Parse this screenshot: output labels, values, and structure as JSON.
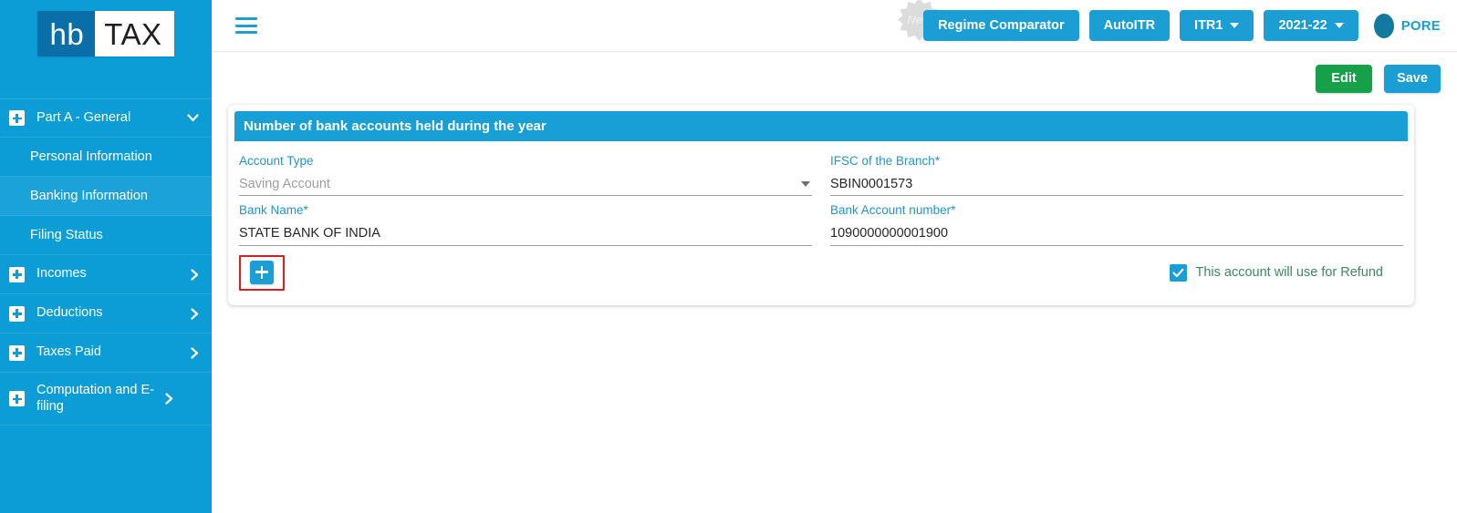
{
  "brand": {
    "logo_mark": "hb",
    "logo_word": "TAX",
    "sidebar_color": "#0c9dd6",
    "accent_color": "#1a9ed4"
  },
  "sidebar": {
    "items": [
      {
        "label": "Part A - General",
        "type": "group",
        "icon": "plus-box-icon",
        "chevron": "chevron-down-icon"
      },
      {
        "label": "Personal Information",
        "type": "sub",
        "active": false
      },
      {
        "label": "Banking Information",
        "type": "sub",
        "active": true
      },
      {
        "label": "Filing Status",
        "type": "sub",
        "active": false
      },
      {
        "label": "Incomes",
        "type": "group",
        "icon": "plus-box-icon",
        "chevron": "chevron-right-icon"
      },
      {
        "label": "Deductions",
        "type": "group",
        "icon": "plus-box-icon",
        "chevron": "chevron-right-icon"
      },
      {
        "label": "Taxes Paid",
        "type": "group",
        "icon": "plus-box-icon",
        "chevron": "chevron-right-icon"
      },
      {
        "label": "Computation and E-filing",
        "type": "group",
        "icon": "plus-box-icon",
        "chevron": "chevron-right-icon"
      }
    ]
  },
  "topbar": {
    "menu_icon": "hamburger-icon",
    "new_badge": "New",
    "regime_comparator": "Regime Comparator",
    "auto_itr": "AutoITR",
    "itr_form": "ITR1",
    "assessment_year": "2021-22",
    "user_initials": "PORE"
  },
  "page_actions": {
    "edit_label": "Edit",
    "save_label": "Save"
  },
  "card": {
    "title": "Number of bank accounts held during the year",
    "fields": {
      "account_type": {
        "label": "Account Type",
        "value": "Saving Account",
        "required": false
      },
      "ifsc": {
        "label": "IFSC of the Branch",
        "value": "SBIN0001573",
        "required": true,
        "required_mark": "*"
      },
      "bank_name": {
        "label": "Bank Name",
        "value": "STATE BANK OF INDIA",
        "required": true,
        "required_mark": "*"
      },
      "account_number": {
        "label": "Bank Account number",
        "value": "1090000000001900",
        "required": true,
        "required_mark": "*"
      }
    },
    "add_button_icon": "plus-icon",
    "refund_checkbox": {
      "label": "This account will use for Refund",
      "checked": true
    }
  }
}
